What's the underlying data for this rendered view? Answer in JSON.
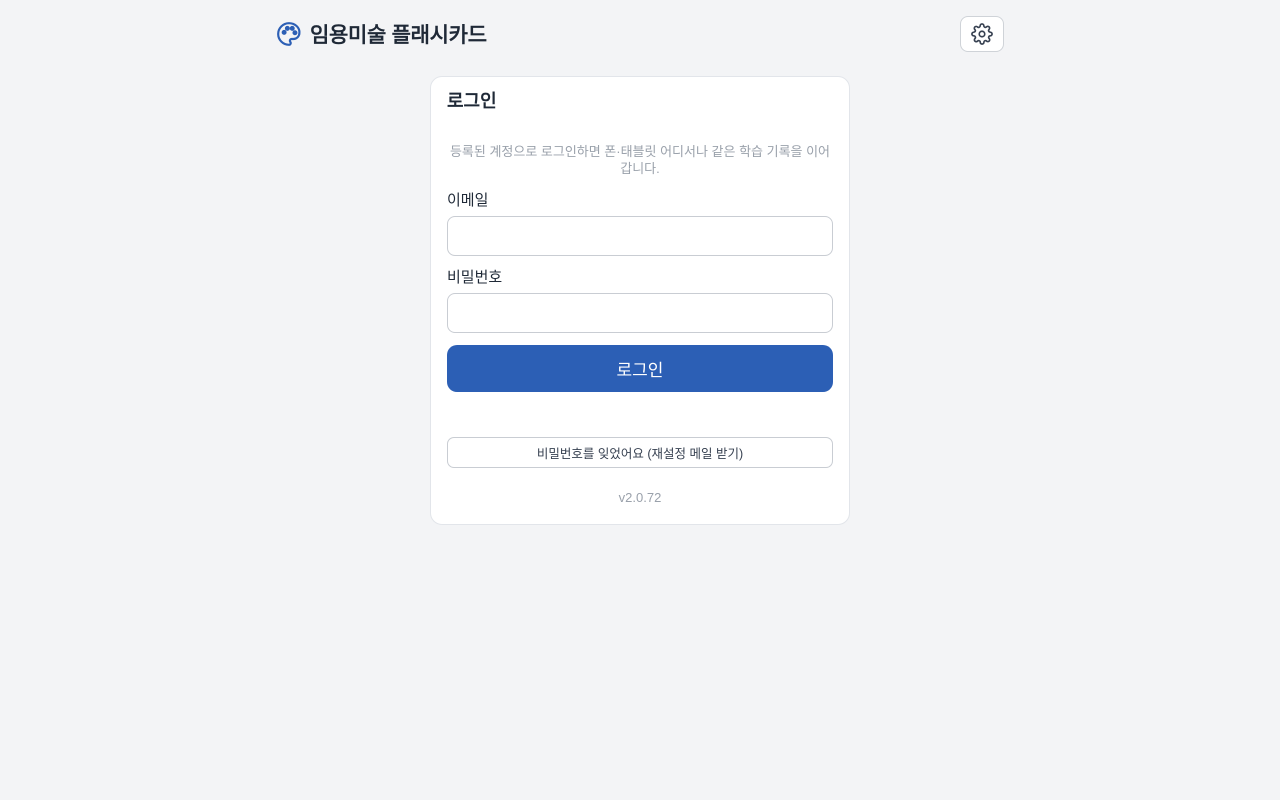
{
  "header": {
    "title": "임용미술 플래시카드",
    "logo_icon": "palette-icon",
    "settings_icon": "gear-icon",
    "brand_color": "#2c5fb5"
  },
  "login": {
    "title": "로그인",
    "description": "등록된 계정으로 로그인하면 폰·태블릿 어디서나 같은 학습 기록을 이어 갑니다.",
    "email_label": "이메일",
    "email_value": "",
    "password_label": "비밀번호",
    "password_value": "",
    "submit_label": "로그인",
    "forgot_label": "비밀번호를 잊었어요 (재설정 메일 받기)",
    "version": "v2.0.72"
  }
}
